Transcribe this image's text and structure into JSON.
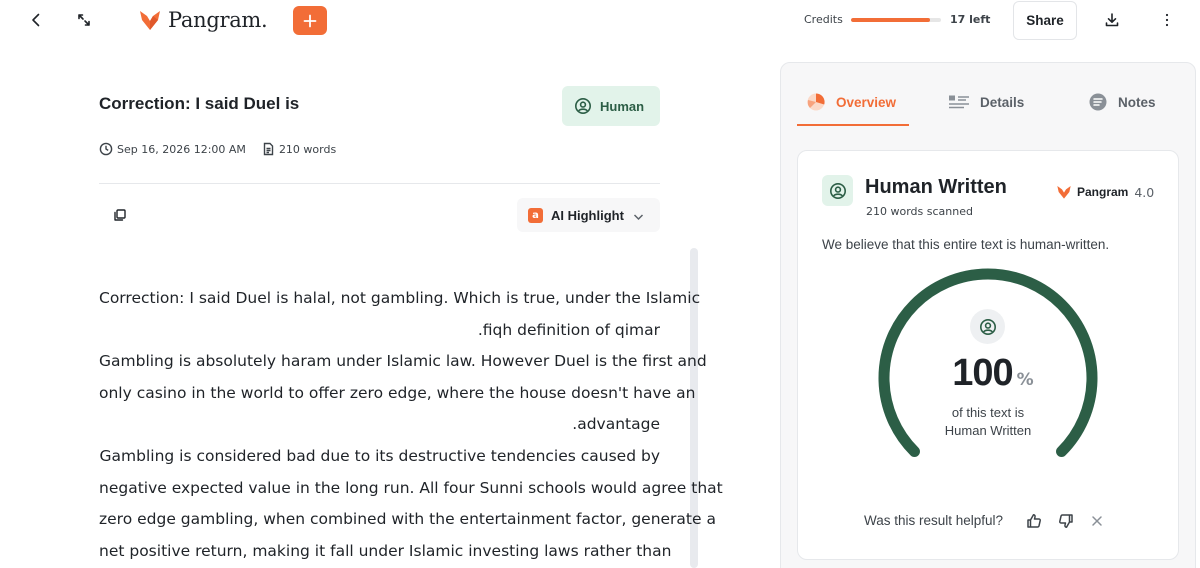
{
  "header": {
    "logo_text": "Pangram.",
    "credits_label": "Credits",
    "credits_fraction": 0.88,
    "credits_left": "17 left",
    "share_label": "Share"
  },
  "document": {
    "title": "Correction: I said Duel is",
    "classification": "Human",
    "date": "Sep 16, 2026 12:00 AM",
    "word_count": "210 words",
    "highlight_label": "AI Highlight",
    "highlight_mark": "a",
    "lines": [
      "Correction: I said Duel is halal, not gambling. Which is true, under the Islamic",
      ".fiqh definition of qimar",
      "Gambling is absolutely haram under Islamic law. However Duel is the first and",
      "only casino in the world to offer zero edge, where the house doesn't have an",
      ".advantage",
      "Gambling is considered bad due to its destructive tendencies caused by",
      "negative expected value in the long run. All four Sunni schools would agree that",
      "zero edge gambling, when combined with the entertainment factor, generate a",
      "net positive return, making it fall under Islamic investing laws rather than"
    ]
  },
  "panel": {
    "tabs": [
      {
        "label": "Overview"
      },
      {
        "label": "Details"
      },
      {
        "label": "Notes"
      }
    ],
    "card": {
      "title": "Human Written",
      "subtitle": "210 words scanned",
      "model_name": "Pangram",
      "model_version": "4.0",
      "verdict": "We believe that this entire text is human-written.",
      "score": "100",
      "score_fraction": 1.0,
      "score_unit": "%",
      "caption_line1": "of this text is",
      "caption_line2": "Human Written",
      "helpful_question": "Was this result helpful?"
    }
  },
  "colors": {
    "accent": "#f26d37",
    "human_green": "#2c5e46",
    "human_bg": "#e2f3ea"
  },
  "icons": {
    "back": "chevron-left-icon",
    "expand": "expand-icon",
    "add": "plus-icon",
    "download": "download-icon",
    "more": "more-vertical-icon",
    "human": "user-circle-icon",
    "clock": "clock-icon",
    "doc": "document-icon",
    "copy": "copy-icon",
    "chevron": "chevron-down-icon"
  }
}
